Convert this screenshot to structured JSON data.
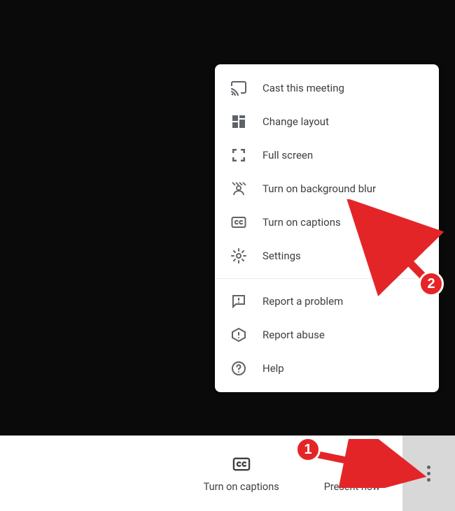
{
  "menu": {
    "section1": [
      {
        "label": "Cast this meeting",
        "icon": "cast"
      },
      {
        "label": "Change layout",
        "icon": "layout"
      },
      {
        "label": "Full screen",
        "icon": "fullscreen"
      },
      {
        "label": "Turn on background blur",
        "icon": "blur"
      },
      {
        "label": "Turn on captions",
        "icon": "cc"
      },
      {
        "label": "Settings",
        "icon": "gear"
      }
    ],
    "section2": [
      {
        "label": "Report a problem",
        "icon": "feedback"
      },
      {
        "label": "Report abuse",
        "icon": "warn"
      },
      {
        "label": "Help",
        "icon": "help"
      }
    ]
  },
  "bottom": {
    "captions": "Turn on captions",
    "present": "Present now"
  },
  "annotations": {
    "badge1": "1",
    "badge2": "2"
  }
}
